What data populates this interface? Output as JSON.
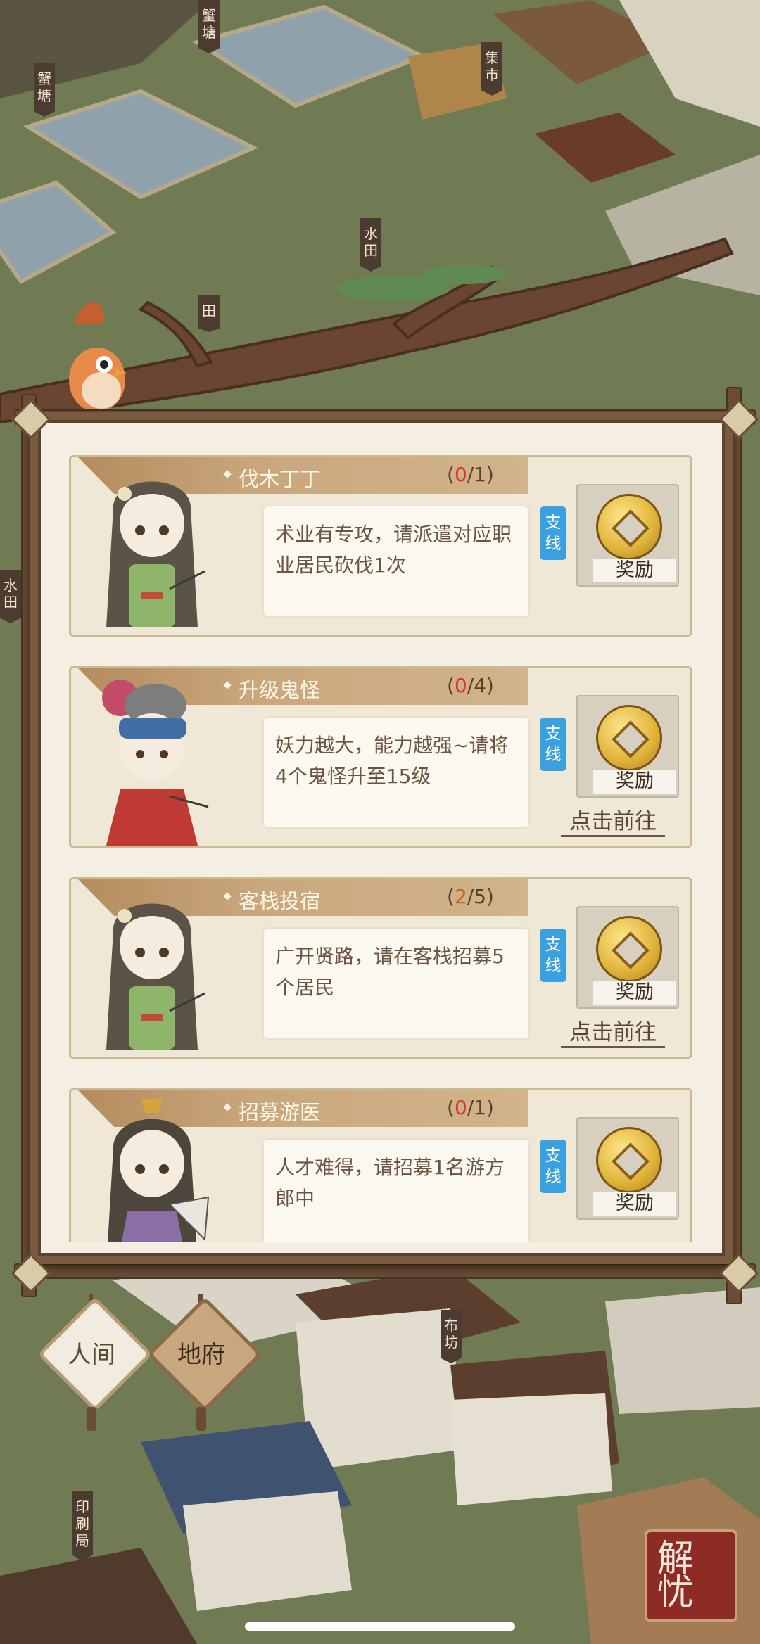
{
  "map_labels": {
    "crab_pond_1": "蟹塘",
    "crab_pond_2": "蟹塘",
    "market": "集市",
    "paddy_1": "水田",
    "paddy_2": "田",
    "paddy_3": "水田",
    "cloth_shop": "布坊",
    "printing_house": "印刷局"
  },
  "quests": [
    {
      "title": "伐木丁丁",
      "progress_done": "0",
      "progress_total": "/1",
      "desc": "术业有专攻，请派遣对应职业居民砍伐1次",
      "tag": "支线",
      "reward_label": "奖励",
      "goto": ""
    },
    {
      "title": "升级鬼怪",
      "progress_done": "0",
      "progress_total": "/4",
      "desc": "妖力越大，能力越强~请将4个鬼怪升至15级",
      "tag": "支线",
      "reward_label": "奖励",
      "goto": "点击前往"
    },
    {
      "title": "客栈投宿",
      "progress_done": "2",
      "progress_total": "/5",
      "desc": "广开贤路，请在客栈招募5个居民",
      "tag": "支线",
      "reward_label": "奖励",
      "goto": "点击前往"
    },
    {
      "title": "招募游医",
      "progress_done": "0",
      "progress_total": "/1",
      "desc": "人才难得，请招募1名游方郎中",
      "tag": "支线",
      "reward_label": "奖励",
      "goto": ""
    }
  ],
  "nav": {
    "human_world": "人间",
    "underworld": "地府"
  },
  "solve_button": "解忧",
  "colors": {
    "frame": "#7a5a40",
    "panel": "#f4efe2",
    "tag": "#3aa0e0",
    "progress_zero": "#d63a2a"
  }
}
